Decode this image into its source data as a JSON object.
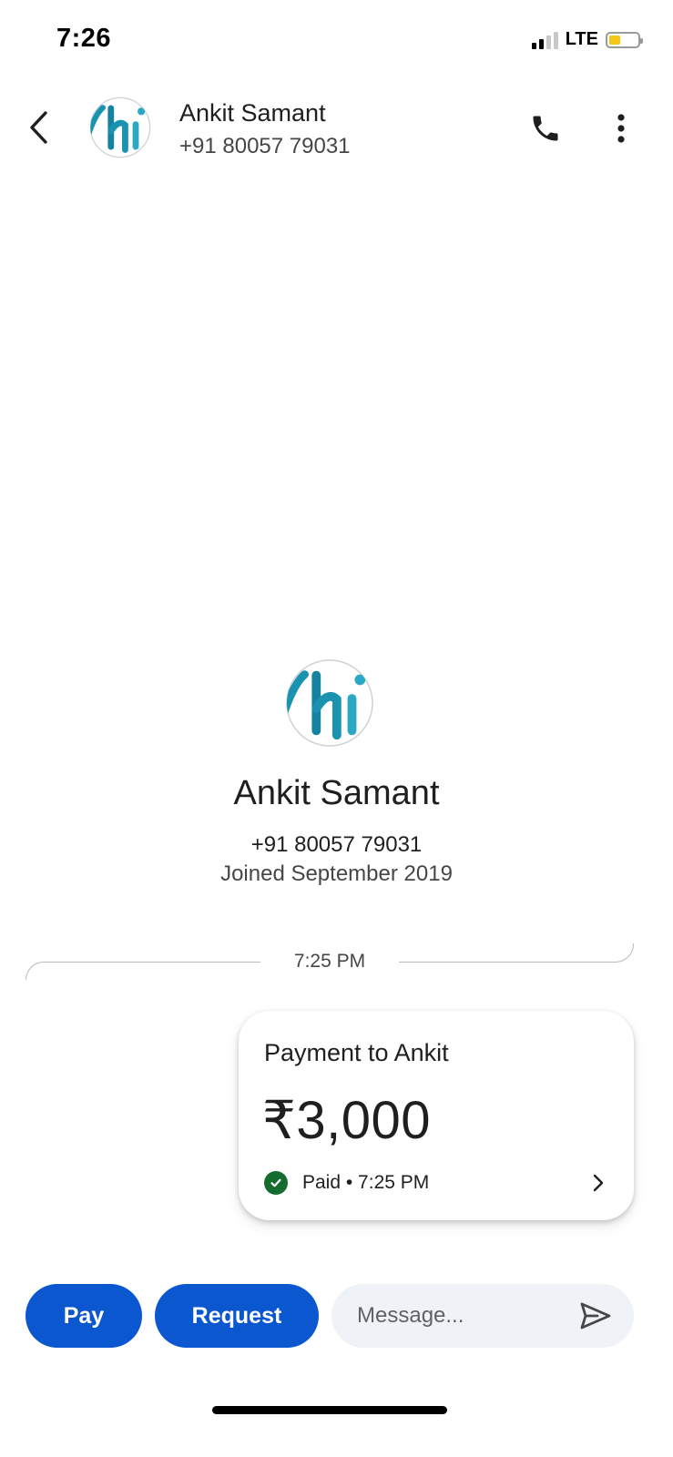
{
  "status_bar": {
    "time": "7:26",
    "network": "LTE",
    "signal_bars_filled": 2,
    "signal_bars_total": 4,
    "battery_level": 0.3,
    "battery_color": "#f5c518"
  },
  "header": {
    "contact_name": "Ankit Samant",
    "contact_phone": "+91 80057 79031",
    "back_icon": "chevron-left-icon",
    "call_icon": "phone-icon",
    "more_icon": "more-vert-icon"
  },
  "profile": {
    "name": "Ankit Samant",
    "phone": "+91 80057 79031",
    "joined": "Joined September 2019",
    "avatar_text": "hi",
    "avatar_color": "#1a93b0"
  },
  "conversation": {
    "divider_time": "7:25 PM",
    "payment_card": {
      "title": "Payment to Ankit",
      "amount": "₹3,000",
      "status": "Paid • 7:25 PM",
      "status_color": "#146c2e",
      "status_icon": "check-circle-icon",
      "chevron_icon": "chevron-right-icon"
    }
  },
  "bottom_bar": {
    "pay_label": "Pay",
    "request_label": "Request",
    "message_placeholder": "Message...",
    "send_icon": "send-icon",
    "accent_color": "#0b57d0"
  }
}
